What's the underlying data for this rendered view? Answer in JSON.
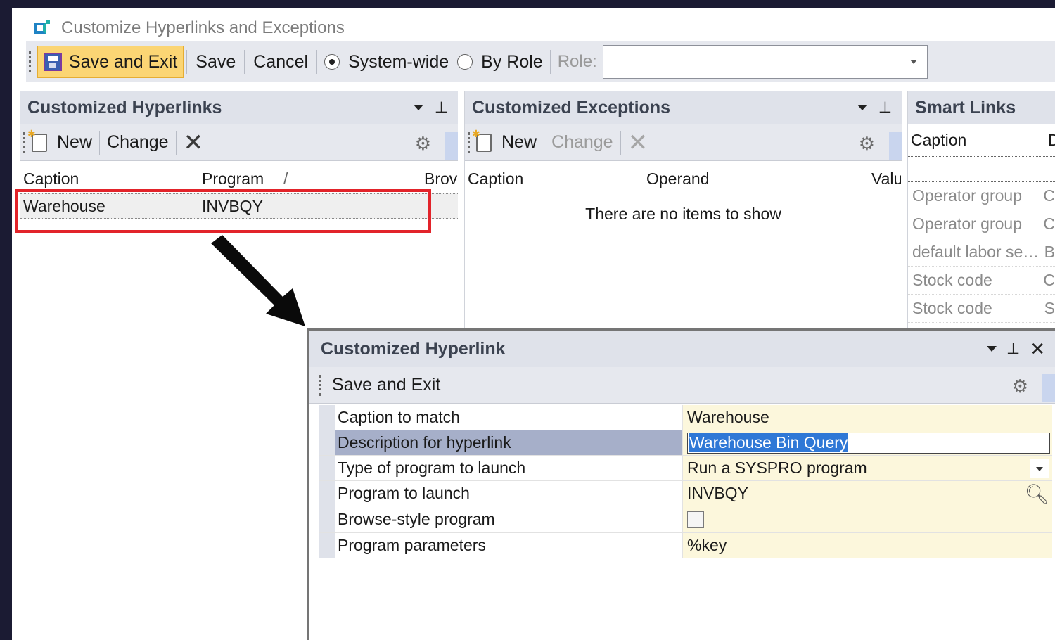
{
  "window": {
    "title": "Customize Hyperlinks and Exceptions"
  },
  "toolbar": {
    "save_exit_label": "Save and Exit",
    "save_label": "Save",
    "cancel_label": "Cancel",
    "system_wide_label": "System-wide",
    "by_role_label": "By Role",
    "role_label": "Role:",
    "role_value": "",
    "selected_scope": "System-wide"
  },
  "hyperlinks_panel": {
    "title": "Customized Hyperlinks",
    "new_label": "New",
    "change_label": "Change",
    "columns": [
      "Caption",
      "Program",
      "/",
      "Brov"
    ],
    "rows": [
      {
        "caption": "Warehouse",
        "program": "INVBQY"
      }
    ]
  },
  "exceptions_panel": {
    "title": "Customized Exceptions",
    "new_label": "New",
    "change_label": "Change",
    "columns": [
      "Caption",
      "Operand",
      "Valu"
    ],
    "empty_message": "There are no items to show"
  },
  "smart_links_panel": {
    "title": "Smart Links",
    "columns": [
      "Caption",
      "D"
    ],
    "rows": [
      {
        "caption": "Operator group",
        "next": "C"
      },
      {
        "caption": "Operator group",
        "next": "C"
      },
      {
        "caption": "default labor se…",
        "next": "B"
      },
      {
        "caption": "Stock code",
        "next": "C"
      },
      {
        "caption": "Stock code",
        "next": "S"
      }
    ]
  },
  "dialog": {
    "title": "Customized Hyperlink",
    "save_exit_label": "Save and Exit",
    "properties": [
      {
        "name": "Caption to match",
        "value": "Warehouse"
      },
      {
        "name": "Description for hyperlink",
        "value": "Warehouse Bin Query"
      },
      {
        "name": "Type of program to launch",
        "value": "Run a SYSPRO program"
      },
      {
        "name": "Program to launch",
        "value": "INVBQY"
      },
      {
        "name": "Browse-style program",
        "value": "",
        "checked": false
      },
      {
        "name": "Program parameters",
        "value": "%key"
      }
    ]
  },
  "colors": {
    "highlight_box": "#e2232a",
    "selected_property": "#a6afc9",
    "selected_text": "#2f78d6",
    "value_bg": "#fcf7dc"
  }
}
